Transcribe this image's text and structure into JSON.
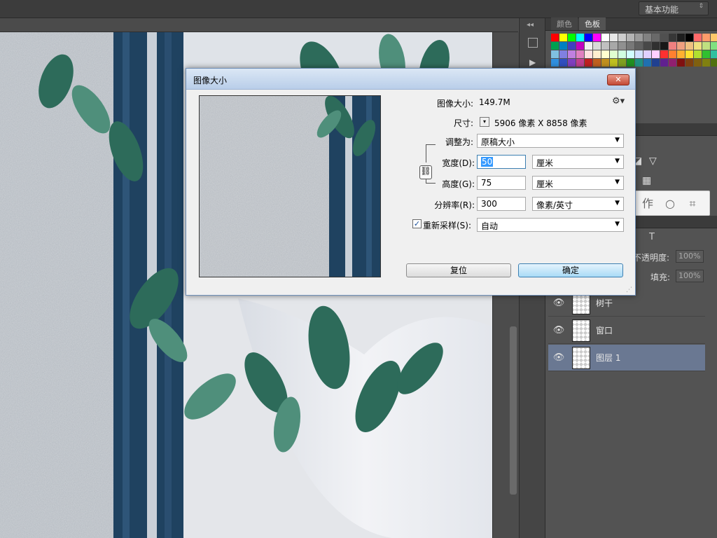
{
  "topbar": {
    "workspace": "基本功能"
  },
  "panels": {
    "swatches": {
      "tabs": [
        "颜色",
        "色板"
      ],
      "active_tab": "色板"
    },
    "adjust_icons": [],
    "layers": {
      "opacity_label": "不透明度:",
      "opacity_value": "100%",
      "fill_label": "填充:",
      "fill_value": "100%",
      "items": [
        {
          "name": "树干",
          "visible": true,
          "selected": false
        },
        {
          "name": "窗口",
          "visible": true,
          "selected": false
        },
        {
          "name": "图层 1",
          "visible": true,
          "selected": true
        }
      ]
    }
  },
  "dialog": {
    "title": "图像大小",
    "close_label": "✕",
    "image_size_label": "图像大小:",
    "image_size_value": "149.7M",
    "dimensions_label": "尺寸:",
    "dimensions_value": "5906 像素  X  8858 像素",
    "fit_label": "调整为:",
    "fit_value": "原稿大小",
    "width_label": "宽度(D):",
    "width_value": "50",
    "width_unit": "厘米",
    "height_label": "高度(G):",
    "height_value": "75",
    "height_unit": "厘米",
    "resolution_label": "分辨率(R):",
    "resolution_value": "300",
    "resolution_unit": "像素/英寸",
    "resample_label": "重新采样(S):",
    "resample_checked": true,
    "resample_value": "自动",
    "reset_button": "复位",
    "ok_button": "确定"
  },
  "colors": {
    "accent": "#3c7fb1",
    "selected_layer": "#6a7892"
  }
}
